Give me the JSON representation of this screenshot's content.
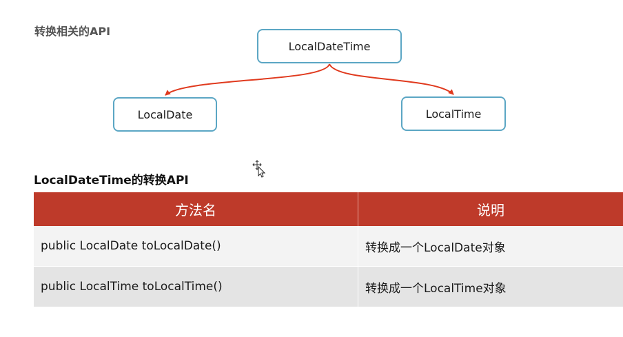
{
  "section_title": "转换相关的API",
  "diagram": {
    "root": "LocalDateTime",
    "left": "LocalDate",
    "right": "LocalTime",
    "box_border_color": "#5ba6c4",
    "arrow_color": "#e03a1e"
  },
  "table": {
    "title": "LocalDateTime的转换API",
    "header_color": "#be3a2a",
    "headers": [
      "方法名",
      "说明"
    ],
    "rows": [
      {
        "method": "public LocalDate toLocalDate()",
        "desc": "转换成一个LocalDate对象"
      },
      {
        "method": "public LocalTime toLocalTime()",
        "desc": "转换成一个LocalTime对象"
      }
    ]
  },
  "cursor_icon": "move-cursor-icon"
}
